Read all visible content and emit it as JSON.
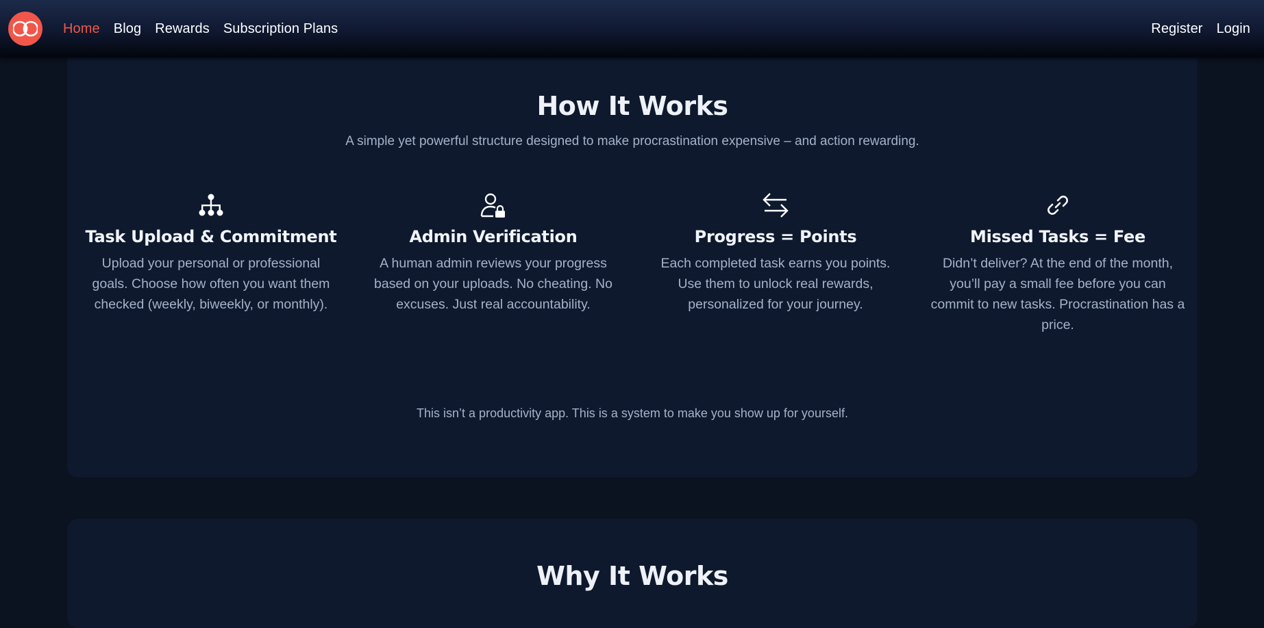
{
  "nav": {
    "links": [
      "Home",
      "Blog",
      "Rewards",
      "Subscription Plans"
    ],
    "auth": [
      "Register",
      "Login"
    ],
    "logo_icon": "infinity-lightning-icon",
    "accent": "#f0574a"
  },
  "how_it_works": {
    "title": "How It Works",
    "subtitle": "A simple yet powerful structure designed to make procrastination expensive – and action rewarding.",
    "features": [
      {
        "icon": "sitemap-icon",
        "title": "Task Upload & Commitment",
        "description": "Upload your personal or professional goals. Choose how often you want them checked (weekly, biweekly, or monthly)."
      },
      {
        "icon": "user-lock-icon",
        "title": "Admin Verification",
        "description": "A human admin reviews your progress based on your uploads. No cheating. No excuses. Just real accountability."
      },
      {
        "icon": "exchange-arrows-icon",
        "title": "Progress = Points",
        "description": "Each completed task earns you points. Use them to unlock real rewards, personalized for your journey."
      },
      {
        "icon": "link-icon",
        "title": "Missed Tasks = Fee",
        "description": "Didn’t deliver? At the end of the month, you’ll pay a small fee before you can commit to new tasks. Procrastination has a price."
      }
    ],
    "tagline": "This isn’t a productivity app. This is a system to make you show up for yourself."
  },
  "why_it_works": {
    "title": "Why It Works"
  }
}
